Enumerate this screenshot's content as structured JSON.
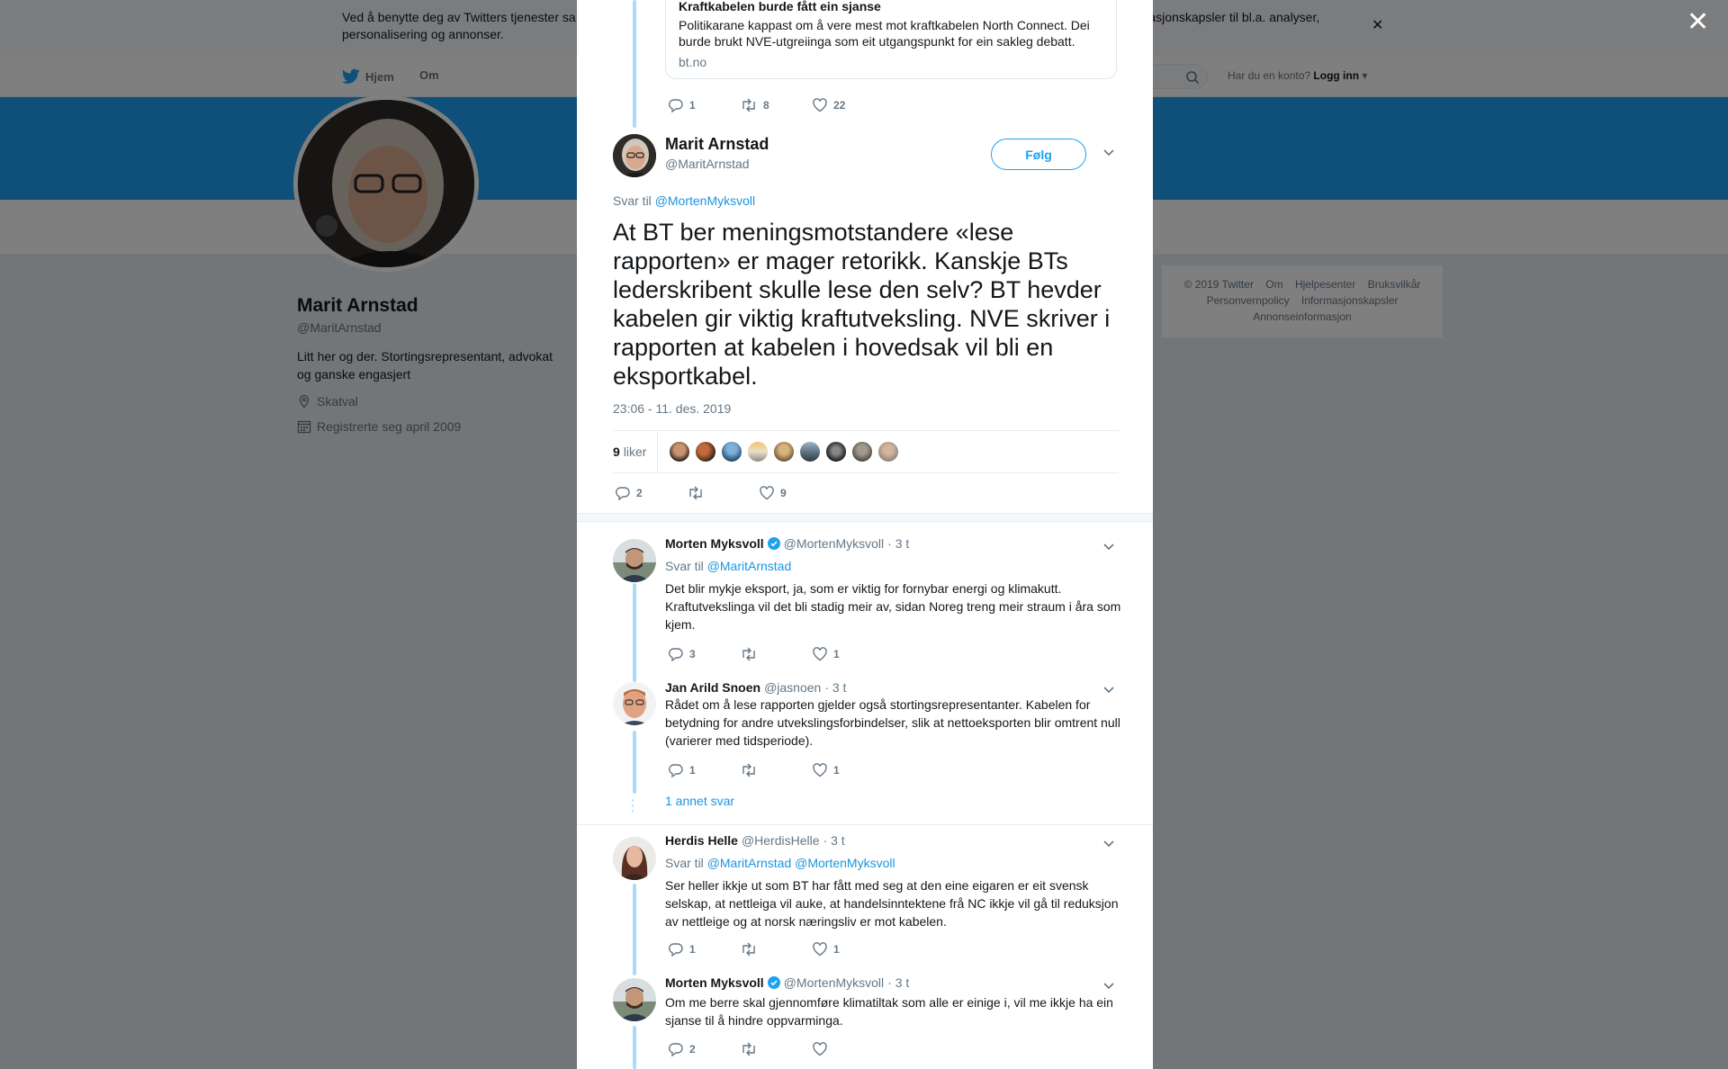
{
  "background": {
    "cookie_notice": "Ved å benytte deg av Twitters tjenester samtykker du i vår bruk av informasjonskapsler. Vi og våre partnere opererer globalt og bruker informasjonskapsler til bl.a. analyser, personalisering og annonser.",
    "cookie_text_left": "Ved å benytte deg av Twitters tjenester sa",
    "cookie_text_right": "informasjonskapsler til bl.a. analyser,",
    "cookie_text_line2": "personalisering og annonser.",
    "nav": {
      "home": "Hjem",
      "about": "Om",
      "have_account": "Har du en konto?",
      "login": "Logg inn"
    },
    "profile": {
      "name": "Marit Arnstad",
      "handle": "@MaritArnstad",
      "bio": "Litt her og der. Stortingsrepresentant, advokat og ganske engasjert",
      "location": "Skatval",
      "joined": "Registrerte seg april 2009"
    },
    "footer": [
      "© 2019 Twitter",
      "Om",
      "Hjelpesenter",
      "Bruksvilkår",
      "Personvernpolicy",
      "Informasjonskapsler",
      "Annonseinformasjon"
    ]
  },
  "quoted": {
    "title": "Kraftkabelen burde fått ein sjanse",
    "description": "Politikarane kappast om å vere mest mot kraftkabelen North Connect. Dei burde brukt NVE-utgreiinga som eit utgangspunkt for ein sakleg debatt.",
    "domain": "bt.no",
    "replies": "1",
    "retweets": "8",
    "likes": "22"
  },
  "main_tweet": {
    "name": "Marit Arnstad",
    "handle": "@MaritArnstad",
    "follow_label": "Følg",
    "replying_prefix": "Svar til",
    "replying_to": "@MortenMyksvoll",
    "text": "At BT ber meningsmotstandere «lese rapporten» er mager retorikk. Kanskje BTs lederskribent skulle lese den selv? BT hevder kabelen gir viktig kraftutveksling. NVE skriver i rapporten at kabelen i hovedsak vil bli en eksportkabel.",
    "timestamp": "23:06 - 11. des. 2019",
    "likes_count": "9",
    "likes_label": "liker",
    "replies": "2",
    "retweets": "",
    "likes": "9"
  },
  "replies": [
    {
      "name": "Morten Myksvoll",
      "handle": "@MortenMyksvoll",
      "time": "· 3 t",
      "verified": true,
      "replying_prefix": "Svar til",
      "replying_to": "@MaritArnstad",
      "text": "Det blir mykje eksport, ja, som er viktig for fornybar energi og klimakutt. Kraftutvekslinga vil det bli stadig meir av, sidan Noreg treng meir straum i åra som kjem.",
      "replies": "3",
      "retweets": "",
      "likes": "1"
    },
    {
      "name": "Jan Arild Snoen",
      "handle": "@jasnoen",
      "time": "· 3 t",
      "verified": false,
      "text": "Rådet om å lese rapporten gjelder også stortingsrepresentanter. Kabelen for betydning for andre utvekslingsforbindelser, slik at nettoeksporten blir omtrent null (varierer med tidsperiode).",
      "replies": "1",
      "retweets": "",
      "likes": "1"
    },
    {
      "name": "Herdis Helle",
      "handle": "@HerdisHelle",
      "time": "· 3 t",
      "verified": false,
      "replying_prefix": "Svar til",
      "replying_to": "@MaritArnstad @MortenMyksvoll",
      "text": "Ser heller ikkje ut som BT har fått med seg at den eine eigaren er eit svensk selskap, at nettleiga vil auke, at handelsinntektene frå NC ikkje vil gå til reduksjon av nettleige og at norsk næringsliv er mot kabelen.",
      "replies": "1",
      "retweets": "",
      "likes": "1"
    },
    {
      "name": "Morten Myksvoll",
      "handle": "@MortenMyksvoll",
      "time": "· 3 t",
      "verified": true,
      "text": "Om me berre skal gjennomføre klimatiltak som alle er einige i, vil me ikkje ha ein sjanse til å hindre oppvarminga.",
      "replies": "2",
      "retweets": "",
      "likes": ""
    }
  ],
  "more_replies": "1 annet svar",
  "colors": {
    "accent": "#1da1f2",
    "link": "#1b95e0",
    "muted": "#657786",
    "thread": "#a9dcf8"
  }
}
